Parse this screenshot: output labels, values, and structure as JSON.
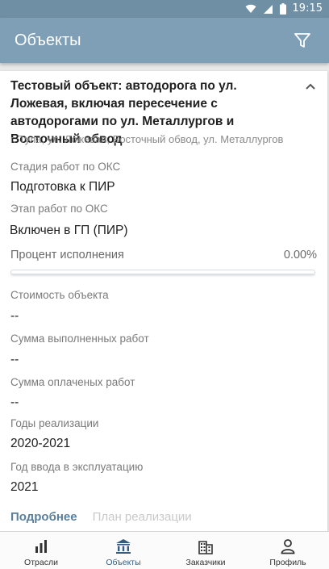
{
  "status_bar": {
    "time": "19:15",
    "icons": [
      "wifi-icon",
      "signal-icon",
      "battery-icon"
    ]
  },
  "app_bar": {
    "title": "Объекты",
    "filter_icon": "filter-icon"
  },
  "object": {
    "title": "Тестовый объект: автодорога по ул. Ложевая, включая пересечение с автодорогами по ул. Металлургов и Восточный обвод",
    "address": "г. Тула, ул. Ложевая, Восточный обвод, ул. Металлургов",
    "collapse_icon": "chevron-up-icon",
    "fields": {
      "stage_label": "Стадия работ по ОКС",
      "stage_value": "Подготовка к ПИР",
      "phase_label": "Этап работ по ОКС",
      "phase_value": "Включен в ГП (ПИР)",
      "cost_label": "Стоимость объекта",
      "cost_value": "--",
      "done_label": "Сумма выполненных работ",
      "done_value": "--",
      "paid_label": "Сумма оплаченых работ",
      "paid_value": "--",
      "years_label": "Годы реализации",
      "years_value": "2020-2021",
      "commission_label": "Год ввода в эксплуатацию",
      "commission_value": "2021"
    },
    "progress": {
      "label": "Процент исполнения",
      "value_text": "0.00%",
      "fraction": 0.0
    },
    "links": {
      "more": "Подробнее",
      "plan": "План реализации"
    }
  },
  "nav": {
    "items": [
      {
        "label": "Отрасли",
        "icon": "bar-chart-icon",
        "active": false
      },
      {
        "label": "Объекты",
        "icon": "bank-building-icon",
        "active": true
      },
      {
        "label": "Заказчики",
        "icon": "office-building-icon",
        "active": false
      },
      {
        "label": "Профиль",
        "icon": "user-icon",
        "active": false
      }
    ]
  },
  "colors": {
    "status_bar": "#6f8fa5",
    "app_bar": "#7f9fb7",
    "accent": "#355c7d",
    "link": "#5a7f9c"
  }
}
